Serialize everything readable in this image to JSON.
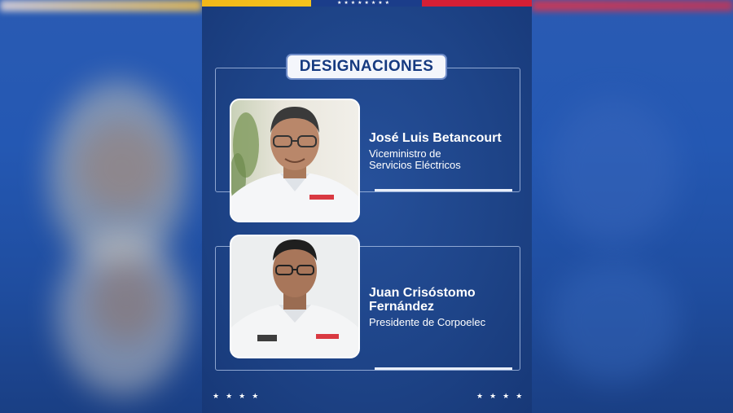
{
  "header": {
    "flag_stars": "★★★★★★★★"
  },
  "title": "DESIGNACIONES",
  "designations": [
    {
      "name": "José Luis Betancourt",
      "role_line1": "Viceministro de",
      "role_line2": "Servicios Eléctricos",
      "shirt_logo": "CORPOELEC"
    },
    {
      "name_line1": "Juan Crisóstomo",
      "name_line2": "Fernández",
      "role": "Presidente de Corpoelec",
      "shirt_logo": "CORPOELEC",
      "shirt_badge": "MPPEE"
    }
  ],
  "footer": {
    "stars_left": "★★★★",
    "stars_right": "★★★★"
  },
  "colors": {
    "panel_blue": "#1e4488",
    "title_text": "#163a80",
    "flag_yellow": "#f5c31c",
    "flag_red": "#d51f35"
  }
}
